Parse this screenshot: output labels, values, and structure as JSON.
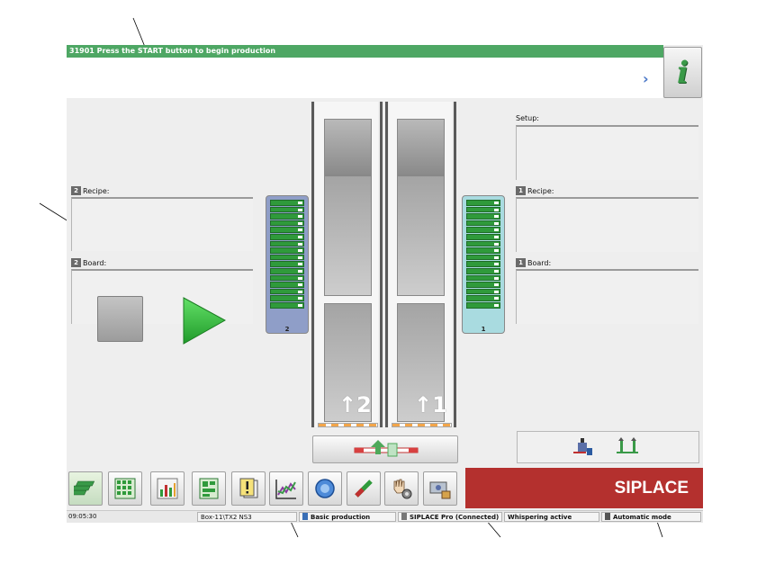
{
  "message": {
    "code_text": "31901 Press the START button to begin production"
  },
  "info_button": {
    "icon": "info-icon",
    "glyph": "i"
  },
  "left_panel": {
    "recipe_label": "Recipe:",
    "board_label": "Board:",
    "lift_icon_label": "2"
  },
  "right_panel": {
    "setup_label": "Setup:",
    "recipe_label": "Recipe:",
    "board_label": "Board:",
    "lift_icon_label": "1"
  },
  "lanes": [
    {
      "number": "2",
      "magazine_label": "2"
    },
    {
      "number": "1",
      "magazine_label": "1"
    }
  ],
  "toolbar": {
    "buttons": [
      {
        "name": "production-icon",
        "active": true
      },
      {
        "name": "grid-icon",
        "active": false
      },
      {
        "name": "bar-chart-icon",
        "active": false
      },
      {
        "name": "layout-icon",
        "active": false
      },
      {
        "name": "warning-document-icon",
        "active": false
      },
      {
        "name": "trend-chart-icon",
        "active": false
      },
      {
        "name": "camera-icon",
        "active": false
      },
      {
        "name": "tool-icon",
        "active": false
      },
      {
        "name": "hand-gear-icon",
        "active": false
      },
      {
        "name": "locked-settings-icon",
        "active": false
      }
    ]
  },
  "brand": {
    "text": "SIPLACE",
    "color": "#b4302e"
  },
  "status": {
    "time": "09:05:30",
    "station": "Box-11\\TX2 NS3",
    "mode": "Basic production",
    "software": "SIPLACE Pro (Connected)",
    "whispering": "Whispering active",
    "operation": "Automatic mode"
  },
  "colors": {
    "message_bar": "#4ea764",
    "magazine_left": "#8f9ec8",
    "magazine_right": "#a9dbe0"
  }
}
